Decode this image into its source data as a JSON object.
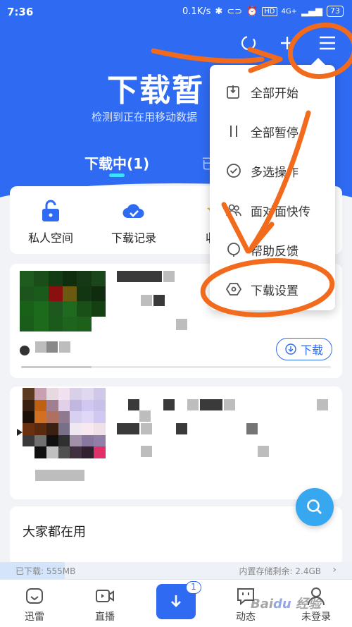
{
  "status_bar": {
    "time": "7:36",
    "speed": "0.1K/s",
    "network_badge": "HD",
    "network_type": "4G+",
    "battery": "73"
  },
  "header": {
    "title": "下载暂",
    "subtitle": "检测到正在用移动数据"
  },
  "tabs": [
    {
      "label": "下载中(1)"
    },
    {
      "label": "已"
    }
  ],
  "quick_actions": [
    {
      "label": "私人空间",
      "icon": "lock-icon"
    },
    {
      "label": "下载记录",
      "icon": "cloud-check-icon"
    },
    {
      "label": "收藏",
      "icon": "star-icon"
    }
  ],
  "download_button": {
    "label": "下载"
  },
  "section": {
    "title": "大家都在用"
  },
  "storage": {
    "downloaded": "已下载: 555MB",
    "free": "内置存储剩余: 2.4GB"
  },
  "bottom_nav": [
    {
      "label": "迅雷",
      "icon": "home-icon"
    },
    {
      "label": "直播",
      "icon": "video-icon"
    },
    {
      "label": "",
      "icon": "download-icon",
      "badge": "1"
    },
    {
      "label": "动态",
      "icon": "chat-icon"
    },
    {
      "label": "未登录",
      "icon": "user-icon"
    }
  ],
  "dropdown_menu": [
    {
      "label": "全部开始",
      "icon": "start-all-icon"
    },
    {
      "label": "全部暂停",
      "icon": "pause-icon"
    },
    {
      "label": "多选操作",
      "icon": "check-circle-icon"
    },
    {
      "label": "面对面快传",
      "icon": "people-icon"
    },
    {
      "label": "帮助反馈",
      "icon": "help-icon"
    },
    {
      "label": "下载设置",
      "icon": "hexagon-settings-icon"
    }
  ],
  "colors": {
    "brand_blue": "#2f6bf2",
    "annotation_orange": "#f26a1b"
  }
}
